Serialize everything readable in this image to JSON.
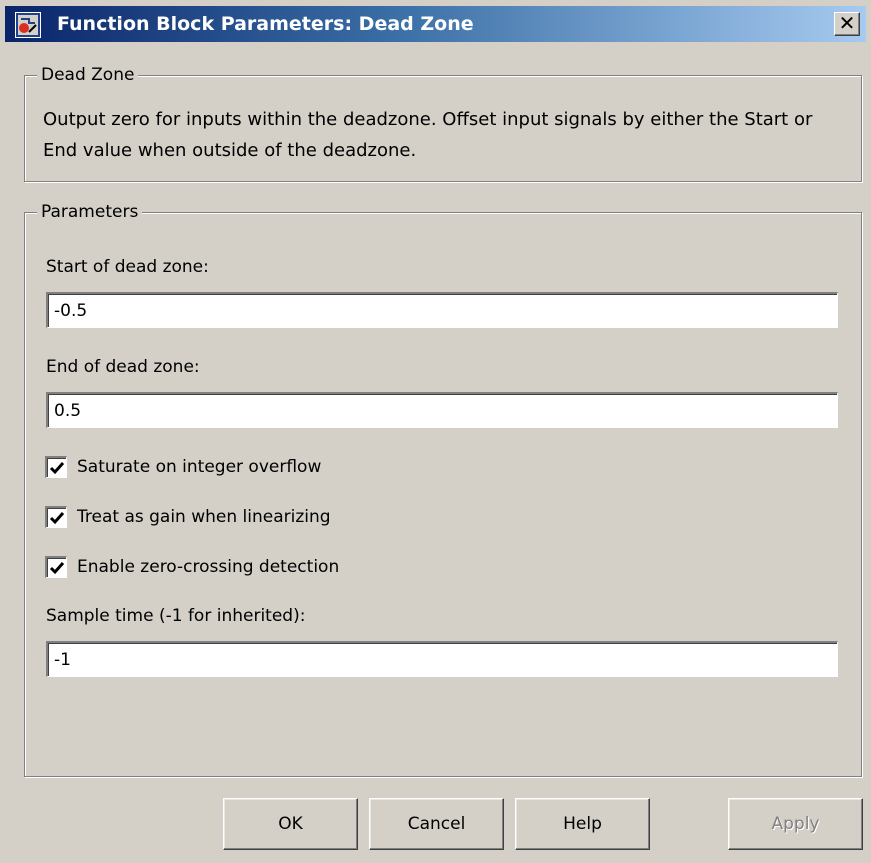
{
  "window": {
    "title": "Function Block Parameters: Dead Zone",
    "close_glyph": "✕"
  },
  "description_group": {
    "legend": "Dead Zone",
    "text": "Output zero for inputs within the deadzone.  Offset input signals by either the Start or End value when outside of the deadzone."
  },
  "parameters_group": {
    "legend": "Parameters",
    "start_label": "Start of dead zone:",
    "start_value": "-0.5",
    "end_label": "End of dead zone:",
    "end_value": "0.5",
    "checkboxes": [
      {
        "label": "Saturate on integer overflow",
        "checked": true
      },
      {
        "label": "Treat as gain when linearizing",
        "checked": true
      },
      {
        "label": "Enable zero-crossing detection",
        "checked": true
      }
    ],
    "sample_time_label": "Sample time (-1 for inherited):",
    "sample_time_value": "-1"
  },
  "buttons": {
    "ok": "OK",
    "cancel": "Cancel",
    "help": "Help",
    "apply": "Apply"
  },
  "colors": {
    "dialog_bg": "#d4d0c8",
    "titlebar_start": "#0a246a",
    "titlebar_end": "#a6caf0",
    "disabled_text": "#808080"
  },
  "icons": {
    "title_icon": "simulink-block-icon",
    "check": "checkmark-icon"
  }
}
